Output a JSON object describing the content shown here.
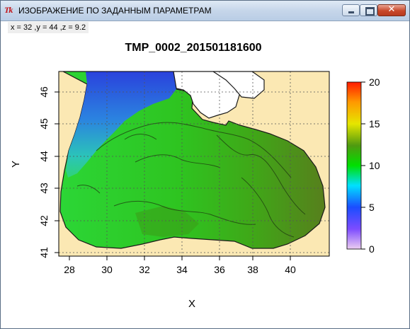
{
  "window": {
    "icon_text": "Tk",
    "title": "ИЗОБРАЖЕНИЕ ПО ЗАДАННЫМ ПАРАМЕТРАМ",
    "minimize_icon": "minimize-icon",
    "maximize_icon": "maximize-icon",
    "close_icon": "close-icon",
    "close_symbol": "✕"
  },
  "readout": "x = 32 ,y = 44 ,z = 9.2",
  "plot": {
    "title": "TMP_0002_201501181600",
    "xlabel": "X",
    "ylabel": "Y",
    "xticks": [
      "28",
      "30",
      "32",
      "34",
      "36",
      "38",
      "40"
    ],
    "yticks": [
      "41",
      "42",
      "43",
      "44",
      "45",
      "46"
    ],
    "colorbar_ticks": [
      "20",
      "15",
      "10",
      "5",
      "0"
    ],
    "colors": {
      "land": "#fbe8b3",
      "sea_warm": "#4c8a1c",
      "sea_mid": "#28c51c",
      "sea_cool": "#29e06a",
      "sea_cold": "#2a59e6",
      "colorbar_top": "#ff1a00",
      "colorbar_mid": "#00e000",
      "colorbar_bottom": "#e6c3ee"
    }
  }
}
